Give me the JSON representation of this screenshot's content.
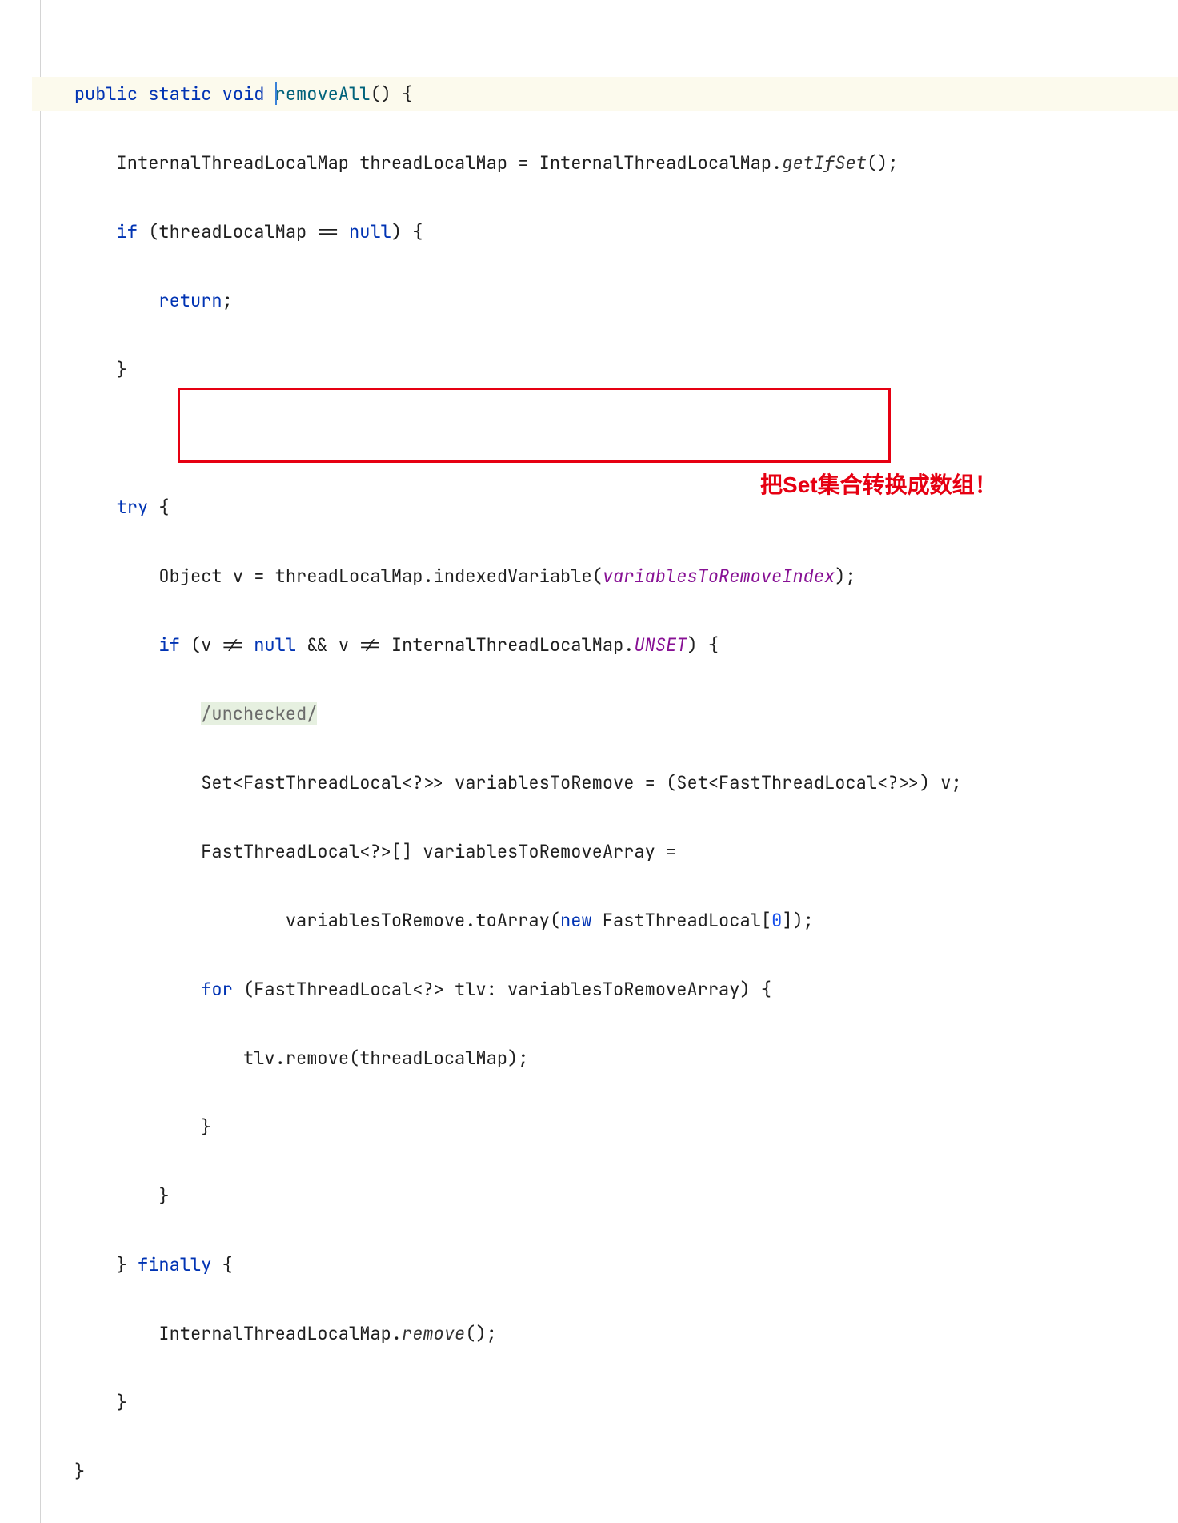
{
  "code": {
    "kw_public": "public",
    "kw_static": "static",
    "kw_void": "void",
    "method_removeAll": "removeAll",
    "paren_open": "()",
    "brace": "{",
    "Internal": "InternalThreadLocalMap",
    "threadLocalMap": "threadLocalMap",
    "eq": " = ",
    "getIfSet": "getIfSet",
    "sc": "();",
    "kw_if": "if",
    "cond_open": " (",
    "eqeq": " == ",
    "kw_null": "null",
    "paren_close": ") {",
    "kw_return": "return",
    "semi": ";",
    "brace_close": "}",
    "kw_try": "try",
    "Object": "Object",
    "v": "v",
    "indexedVariable": "indexedVariable",
    "variablesToRemoveIndex": "variablesToRemoveIndex",
    "close_sc": ");",
    "neq": " != ",
    "andand": " && ",
    "UNSET": "UNSET",
    "unchecked": "/unchecked/",
    "Set": "Set",
    "ltFTL": "<FastThreadLocal<?>>",
    "variablesToRemove": "variablesToRemove",
    "cast_open": " = (",
    "cast_close": ") v;",
    "FTL_arr": "FastThreadLocal<?>[]",
    "variablesToRemoveArray": "variablesToRemoveArray",
    "eq2": " =",
    "toArray": "toArray",
    "kw_new": "new",
    "FTL": "FastThreadLocal",
    "arr_open": "[",
    "zero": "0",
    "arr_close": "]);",
    "kw_for": "for",
    "for_cond": " (FastThreadLocal<?> tlv: variablesToRemoveArray) {",
    "tlv": "tlv",
    "remove_call": "remove",
    "remove_args": "(threadLocalMap);",
    "kw_finally": "finally",
    "remove_static": "remove",
    "remove_noargs": "();"
  },
  "annotation": {
    "prefix": "把",
    "set": "Set",
    "suffix": "集合转换成数组！"
  }
}
